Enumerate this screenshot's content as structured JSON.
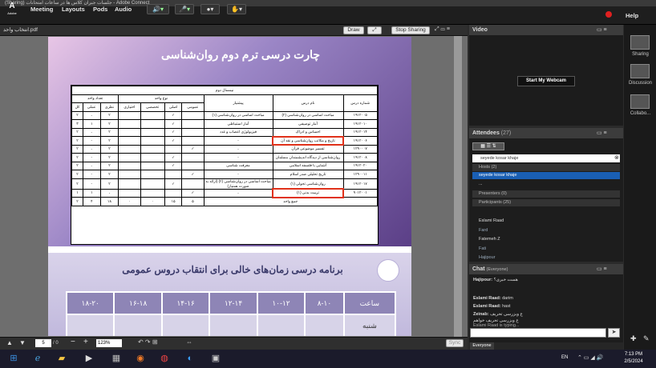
{
  "window": {
    "title": "(Sharing) جلسات جبران کلاس ها در ساعات امتحانات - Adobe Connect"
  },
  "menu": {
    "logo": "A",
    "logo_sub": "Adobe",
    "items": [
      "Meeting",
      "Layouts",
      "Pods",
      "Audio"
    ],
    "help": "Help"
  },
  "share": {
    "file_name": "انتخاب واحد.pdf",
    "draw_label": "Draw",
    "stop_label": "Stop Sharing",
    "page_current": "5",
    "page_total": "/ 0",
    "zoom": "123%",
    "sync_label": "Sync"
  },
  "slide1": {
    "title": "چارت درسی ترم دوم روان‌شناسی",
    "table_caption": "نیمسال دوم",
    "headers": {
      "code": "شماره درس",
      "name": "نام درس",
      "prereq": "پیشنیاز",
      "unit_type": "نوع واحد",
      "unit_count": "تعداد واحد",
      "general": "عمومی",
      "core": "اصلی",
      "specialized": "تخصصی",
      "elective": "اختیاری",
      "theory": "نظری",
      "practical": "عملی",
      "total": "کل"
    },
    "rows": [
      [
        "۱۹۱۲۰۰۵",
        "مباحث اساسی در روان‌شناسی (۲)",
        "مباحث اساسی در روان‌شناسی (۱)",
        "",
        "✓",
        "",
        "",
        "۲",
        "-",
        "۲"
      ],
      [
        "۱۹۱۲۰۱۰",
        "آمار توصیفی",
        "آمار استنباطی",
        "",
        "✓",
        "",
        "",
        "۲",
        "۱",
        "۳"
      ],
      [
        "۱۹۱۲۰۱۴",
        "احساس و ادراک",
        "فیزیولوژی اعصاب و غدد",
        "",
        "✓",
        "",
        "",
        "۲",
        "-",
        "۲"
      ],
      [
        "۱۹۱۲۰۰۶",
        "تاریخ و مکاتب روان‌شناسی و نقد آن",
        "-",
        "",
        "✓",
        "",
        "",
        "۲",
        "-",
        "۲"
      ],
      [
        "۱۲۹۰۰۰۷",
        "تفسیر موضوعی قرآن",
        "-",
        "✓",
        "",
        "",
        "",
        "۲",
        "-",
        "۲"
      ],
      [
        "۱۹۱۲۰۰۸",
        "روان‌شناسی از دیدگاه اندیشمندان مسلمان",
        "-",
        "",
        "✓",
        "",
        "",
        "۲",
        "-",
        "۲"
      ],
      [
        "۱۹۱۲۰۲۰",
        "آشنایی با فلسفه اسلامی",
        "معرفت شناسی",
        "",
        "✓",
        "",
        "",
        "۲",
        "-",
        "۲"
      ],
      [
        "۱۲۹۰۰۱۱",
        "تاریخ تحلیلی صدر اسلام",
        "-",
        "✓",
        "",
        "",
        "",
        "۲",
        "-",
        "۲"
      ],
      [
        "۱۹۱۲۰۱۷",
        "روان‌شناسی تحولی (۱)",
        "مباحث اساسی در روان‌شناسی (۲) (ارائه به صورت همنیاز)",
        "",
        "✓",
        "",
        "",
        "۲",
        "-",
        "۲"
      ],
      [
        "۹۰۱۲۰۰۱",
        "تربیت بدنی (۱)",
        "-",
        "✓",
        "",
        "",
        "",
        "-",
        "۱",
        "۱"
      ]
    ],
    "total_label": "جمع واحد",
    "totals": [
      "۲",
      "۴",
      "۱۸",
      "۰",
      "۰",
      "۱۵",
      "۵"
    ]
  },
  "slide2": {
    "title": "برنامه درسی زمان‌های خالی برای انتقاب دروس عمومی",
    "corner": "ساعت",
    "day": "شنبه",
    "times": [
      "۸-۱۰",
      "۱۰-۱۲",
      "۱۲-۱۴",
      "۱۴-۱۶",
      "۱۶-۱۸",
      "۱۸-۲۰"
    ]
  },
  "video": {
    "title": "Video",
    "webcam_label": "Start My Webcam"
  },
  "attendees": {
    "title": "Attendees",
    "count": "(27)",
    "search_value": "seyede kosar khaje",
    "hosts_label": "Hosts (2)",
    "hosts": [
      "seyede kosar khaje",
      "..."
    ],
    "presenters_label": "Presenters (0)",
    "participants_label": "Participants (25)",
    "participants": [
      "",
      "Eslami Raad",
      "Fard",
      "Fatemeh Z",
      "Fati",
      "Hajipour"
    ]
  },
  "chat": {
    "title": "Chat",
    "scope": "(Everyone)",
    "messages": [
      {
        "who": "Hajipour:",
        "text": "هست خبری؟"
      },
      {
        "who": "",
        "text": ""
      },
      {
        "who": "Eslami Raad:",
        "text": "darim"
      },
      {
        "who": "Eslami Raad:",
        "text": "hast"
      },
      {
        "who": "Zeinab:",
        "text": "ع وبزرسی تحریف"
      },
      {
        "who": "",
        "text": "ع وبزرسی تحریف خواهم"
      },
      {
        "who": "",
        "text": "Eslami Raad is typing..."
      }
    ],
    "tab": "Everyone"
  },
  "layouts": {
    "items": [
      "Sharing",
      "Discussion",
      "Collabo..."
    ]
  },
  "taskbar": {
    "lang": "EN",
    "time": "7:13 PM",
    "date": "2/5/2024"
  },
  "colors": {
    "highlight": "#e0311a",
    "selected": "#1a5fb4"
  }
}
